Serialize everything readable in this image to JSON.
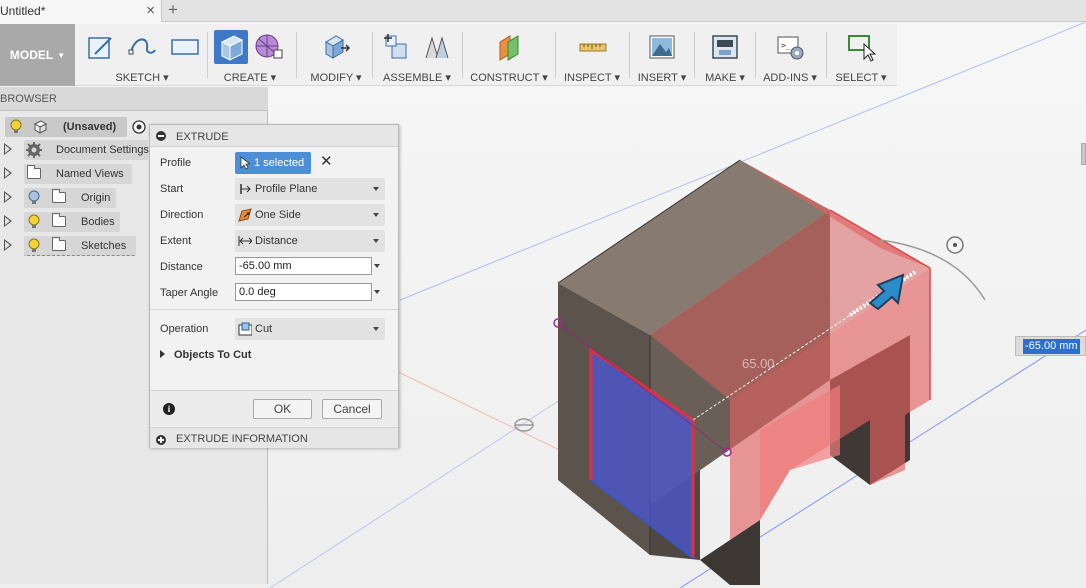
{
  "tab": {
    "title": "Untitled*",
    "close": "×",
    "new": "+"
  },
  "toolbar": {
    "workspace": "MODEL",
    "groups": {
      "sketch": "SKETCH",
      "create": "CREATE",
      "modify": "MODIFY",
      "assemble": "ASSEMBLE",
      "construct": "CONSTRUCT",
      "inspect": "INSPECT",
      "insert": "INSERT",
      "make": "MAKE",
      "addins": "ADD-INS",
      "select": "SELECT"
    }
  },
  "browser": {
    "title": "BROWSER",
    "root": "(Unsaved)",
    "items": [
      {
        "label": "Document Settings",
        "icon": "gear-icon"
      },
      {
        "label": "Named Views",
        "icon": "folder-icon"
      },
      {
        "label": "Origin",
        "icon": "folder-icon"
      },
      {
        "label": "Bodies",
        "icon": "folder-icon"
      },
      {
        "label": "Sketches",
        "icon": "folder-icon"
      }
    ]
  },
  "extrude": {
    "title": "EXTRUDE",
    "profile_label": "Profile",
    "profile_value": "1 selected",
    "start_label": "Start",
    "start_value": "Profile Plane",
    "direction_label": "Direction",
    "direction_value": "One Side",
    "extent_label": "Extent",
    "extent_value": "Distance",
    "distance_label": "Distance",
    "distance_value": "-65.00 mm",
    "taper_label": "Taper Angle",
    "taper_value": "0.0 deg",
    "operation_label": "Operation",
    "operation_value": "Cut",
    "objects_label": "Objects To Cut",
    "ok": "OK",
    "cancel": "Cancel",
    "info": "EXTRUDE INFORMATION"
  },
  "viewport": {
    "dimension_input": "-65.00 mm",
    "dimension_label": "65.00"
  },
  "colors": {
    "selection_blue": "#4d8fd6",
    "cut_preview": "#e46060",
    "profile_face": "#4a56d6"
  }
}
